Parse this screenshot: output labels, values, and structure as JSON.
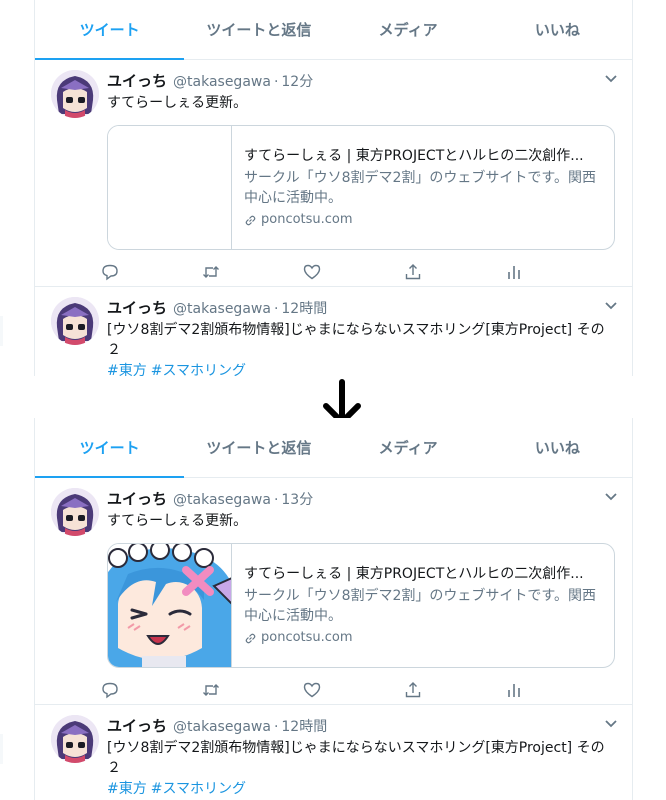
{
  "tabs": [
    "ツイート",
    "ツイートと返信",
    "メディア",
    "いいね"
  ],
  "before": {
    "tweets": [
      {
        "name": "ユイっち",
        "handle": "@takasegawa",
        "separator": "·",
        "time": "12分",
        "text": "すてらーしぇる更新。",
        "card": {
          "title": "すてらーしぇる | 東方PROJECTとハルヒの二次創作...",
          "description": "サークル「ウソ8割デマ2割」のウェブサイトです。関西中心に活動中。",
          "domain": "poncotsu.com",
          "image": "none"
        }
      },
      {
        "name": "ユイっち",
        "handle": "@takasegawa",
        "separator": "·",
        "time": "12時間",
        "text": "[ウソ8割デマ2割頒布物情報]じゃまにならないスマホリング[東方Project] その２",
        "hashtags": [
          "#東方",
          "#スマホリング"
        ]
      }
    ]
  },
  "after": {
    "tweets": [
      {
        "name": "ユイっち",
        "handle": "@takasegawa",
        "separator": "·",
        "time": "13分",
        "text": "すてらーしぇる更新。",
        "card": {
          "title": "すてらーしぇる | 東方PROJECTとハルヒの二次創作...",
          "description": "サークル「ウソ8割デマ2割」のウェブサイトです。関西中心に活動中。",
          "domain": "poncotsu.com",
          "image": "anime-character-thumbnail"
        }
      },
      {
        "name": "ユイっち",
        "handle": "@takasegawa",
        "separator": "·",
        "time": "12時間",
        "text": "[ウソ8割デマ2割頒布物情報]じゃまにならないスマホリング[東方Project] その２",
        "hashtags": [
          "#東方",
          "#スマホリング"
        ]
      }
    ]
  },
  "icons": {
    "actions": [
      "reply-icon",
      "retweet-icon",
      "like-icon",
      "share-icon",
      "analytics-icon"
    ],
    "transition": "down-arrow-icon",
    "menu": "chevron-down-icon",
    "link": "link-icon"
  },
  "colors": {
    "accent": "#1da1f2",
    "hashtag": "#1b95e0",
    "secondary_text": "#657786",
    "border": "#e6ecf0"
  }
}
